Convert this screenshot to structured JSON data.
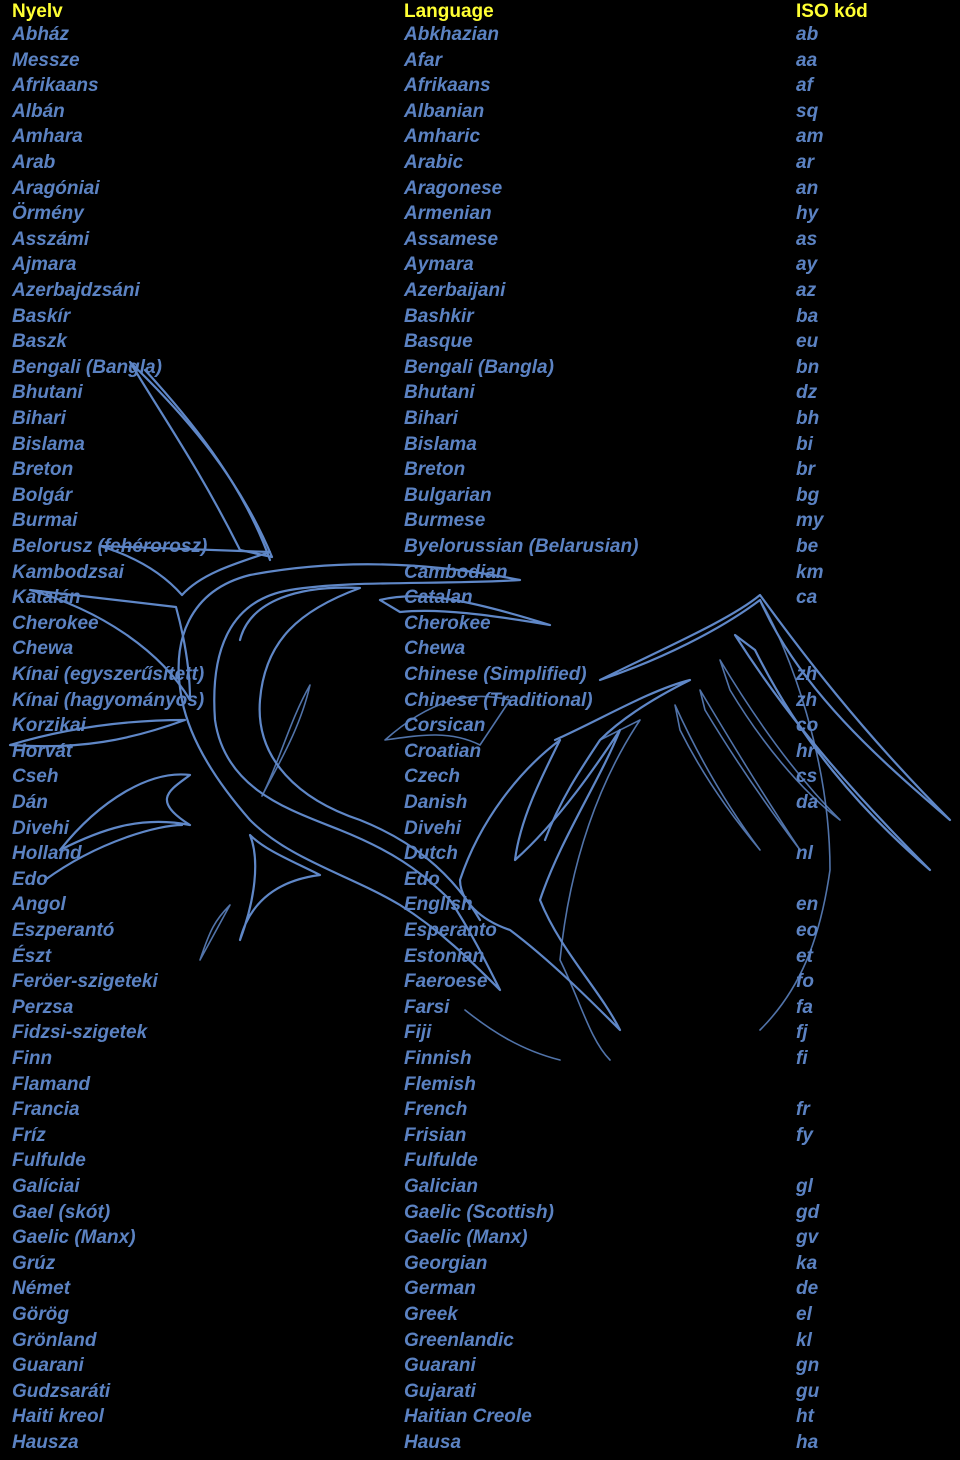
{
  "table": {
    "headers": {
      "hungarian": "Nyelv",
      "english": "Language",
      "iso": "ISO kód"
    },
    "colors": {
      "header": "#ffff33",
      "text": "#5b82c2",
      "background": "#000000"
    },
    "rows": [
      [
        "Abház",
        "Abkhazian",
        "ab"
      ],
      [
        "Messze",
        "Afar",
        "aa"
      ],
      [
        "Afrikaans",
        "Afrikaans",
        "af"
      ],
      [
        "Albán",
        "Albanian",
        "sq"
      ],
      [
        "Amhara",
        "Amharic",
        "am"
      ],
      [
        "Arab",
        "Arabic",
        "ar"
      ],
      [
        "Aragóniai",
        "Aragonese",
        "an"
      ],
      [
        "Örmény",
        "Armenian",
        "hy"
      ],
      [
        "Asszámi",
        "Assamese",
        "as"
      ],
      [
        "Ajmara",
        "Aymara",
        "ay"
      ],
      [
        "Azerbajdzsáni",
        "Azerbaijani",
        "az"
      ],
      [
        "Baskír",
        "Bashkir",
        "ba"
      ],
      [
        "Baszk",
        "Basque",
        "eu"
      ],
      [
        "Bengali (Bangla)",
        "Bengali (Bangla)",
        "bn"
      ],
      [
        "Bhutani",
        "Bhutani",
        "dz"
      ],
      [
        "Bihari",
        "Bihari",
        "bh"
      ],
      [
        "Bislama",
        "Bislama",
        "bi"
      ],
      [
        "Breton",
        "Breton",
        "br"
      ],
      [
        "Bolgár",
        "Bulgarian",
        "bg"
      ],
      [
        "Burmai",
        "Burmese",
        "my"
      ],
      [
        "Belorusz (fehérorosz)",
        "Byelorussian (Belarusian)",
        "be"
      ],
      [
        "Kambodzsai",
        "Cambodian",
        "km"
      ],
      [
        "Katalán",
        "Catalan",
        "ca"
      ],
      [
        "Cherokee",
        "Cherokee",
        ""
      ],
      [
        "Chewa",
        "Chewa",
        ""
      ],
      [
        "Kínai (egyszerűsített)",
        "Chinese (Simplified)",
        "zh"
      ],
      [
        "Kínai (hagyományos)",
        "Chinese (Traditional)",
        "zh"
      ],
      [
        "Korzikai",
        "Corsican",
        "co"
      ],
      [
        "Horvát",
        "Croatian",
        "hr"
      ],
      [
        "Cseh",
        "Czech",
        "cs"
      ],
      [
        "Dán",
        "Danish",
        "da"
      ],
      [
        "Divehi",
        "Divehi",
        ""
      ],
      [
        "Holland",
        "Dutch",
        "nl"
      ],
      [
        "Edo",
        "Edo",
        ""
      ],
      [
        "Angol",
        "English",
        "en"
      ],
      [
        "Eszperantó",
        "Esperanto",
        "eo"
      ],
      [
        "Észt",
        "Estonian",
        "et"
      ],
      [
        "Feröer-szigeteki",
        "Faeroese",
        "fo"
      ],
      [
        "Perzsa",
        "Farsi",
        "fa"
      ],
      [
        "Fidzsi-szigetek",
        "Fiji",
        "fj"
      ],
      [
        "Finn",
        "Finnish",
        "fi"
      ],
      [
        "Flamand",
        "Flemish",
        ""
      ],
      [
        "Francia",
        "French",
        "fr"
      ],
      [
        "Fríz",
        "Frisian",
        "fy"
      ],
      [
        "Fulfulde",
        "Fulfulde",
        ""
      ],
      [
        "Galíciai",
        "Galician",
        "gl"
      ],
      [
        "Gael (skót)",
        "Gaelic (Scottish)",
        "gd"
      ],
      [
        "Gaelic (Manx)",
        "Gaelic (Manx)",
        "gv"
      ],
      [
        "Grúz",
        "Georgian",
        "ka"
      ],
      [
        "Német",
        "German",
        "de"
      ],
      [
        "Görög",
        "Greek",
        "el"
      ],
      [
        "Grönland",
        "Greenlandic",
        "kl"
      ],
      [
        "Guarani",
        "Guarani",
        "gn"
      ],
      [
        "Gudzsaráti",
        "Gujarati",
        "gu"
      ],
      [
        "Haiti kreol",
        "Haitian Creole",
        "ht"
      ],
      [
        "Hausza",
        "Hausa",
        "ha"
      ]
    ]
  },
  "decoration": {
    "icon": "tribal-swirl-ornament"
  }
}
